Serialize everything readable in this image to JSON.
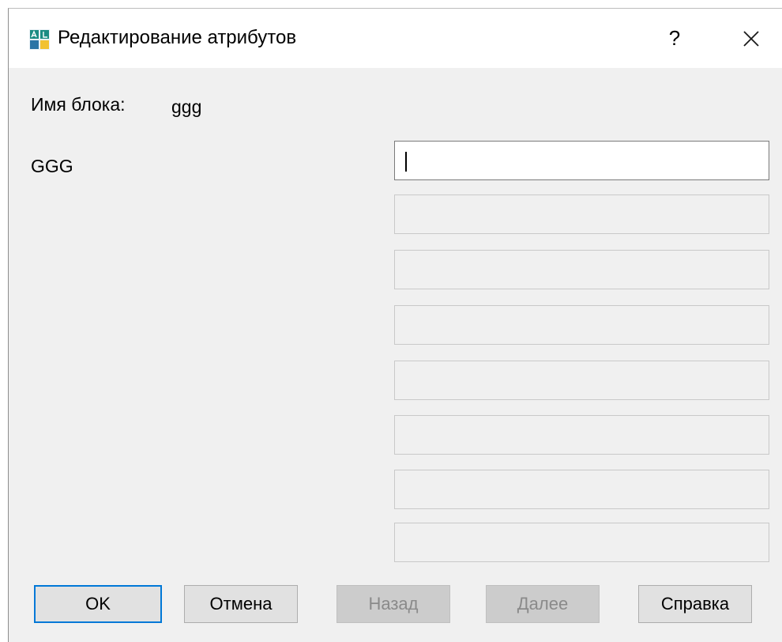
{
  "window": {
    "title": "Редактирование атрибутов",
    "help_label": "?",
    "icon": "attribute-edit-icon",
    "close_icon": "close-icon"
  },
  "block": {
    "name_label": "Имя блока:",
    "name_value": "ggg"
  },
  "attributes": [
    {
      "label": "GGG",
      "value": ""
    }
  ],
  "buttons": {
    "ok": "OK",
    "cancel": "Отмена",
    "back": "Назад",
    "next": "Далее",
    "help": "Справка"
  },
  "colors": {
    "focus_border": "#0078d7",
    "dialog_bg": "#f0f0f0"
  }
}
